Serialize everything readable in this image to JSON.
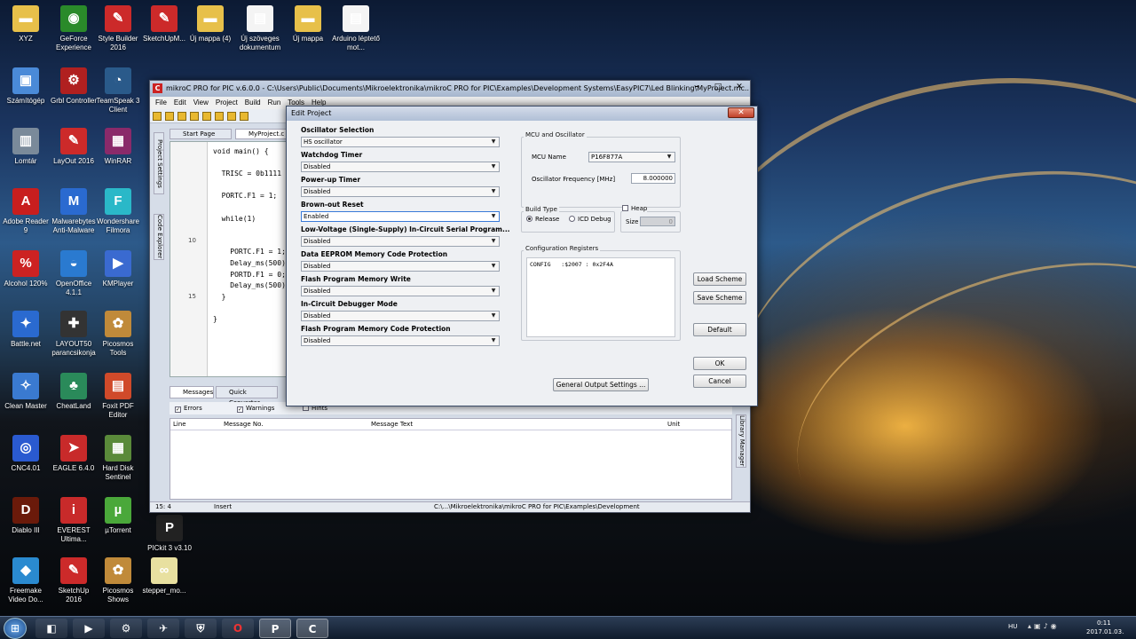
{
  "desktop": {
    "icons": [
      {
        "label": "XYZ",
        "icon": "folder-icon",
        "color": "#e7c04a",
        "glyph": "▬"
      },
      {
        "label": "GeForce Experience",
        "icon": "geforce-icon",
        "color": "#2a8a2a",
        "glyph": "◉"
      },
      {
        "label": "Style Builder 2016",
        "icon": "stylebuilder-icon",
        "color": "#cc2a2a",
        "glyph": "✎"
      },
      {
        "label": "SketchUpM...",
        "icon": "sketchup-icon",
        "color": "#cc2a2a",
        "glyph": "✎"
      },
      {
        "label": "Új mappa (4)",
        "icon": "folder-icon",
        "color": "#e7c04a",
        "glyph": "▬"
      },
      {
        "label": "Új szöveges dokumentum",
        "icon": "document-icon",
        "color": "#f4f4f4",
        "glyph": "▤"
      },
      {
        "label": "Új mappa",
        "icon": "folder-icon",
        "color": "#e7c04a",
        "glyph": "▬"
      },
      {
        "label": "Arduino léptető mot...",
        "icon": "document-icon",
        "color": "#f4f4f4",
        "glyph": "▤"
      },
      {
        "label": "Számítógép",
        "icon": "computer-icon",
        "color": "#4a8ad8",
        "glyph": "▣"
      },
      {
        "label": "Grbl Controller",
        "icon": "grbl-icon",
        "color": "#b02020",
        "glyph": "⚙"
      },
      {
        "label": "TeamSpeak 3 Client",
        "icon": "teamspeak-icon",
        "color": "#2a5a8a",
        "glyph": "◔"
      },
      {
        "label": "Lomtár",
        "icon": "recycle-bin-icon",
        "color": "#7a8a9a",
        "glyph": "▥"
      },
      {
        "label": "LayOut 2016",
        "icon": "layout-icon",
        "color": "#cc2a2a",
        "glyph": "✎"
      },
      {
        "label": "WinRAR",
        "icon": "winrar-icon",
        "color": "#8a2a6a",
        "glyph": "▦"
      },
      {
        "label": "Adobe Reader 9",
        "icon": "adobe-reader-icon",
        "color": "#c81e1e",
        "glyph": "A"
      },
      {
        "label": "Malwarebytes Anti-Malware",
        "icon": "malwarebytes-icon",
        "color": "#2a6ad0",
        "glyph": "M"
      },
      {
        "label": "Wondershare Filmora",
        "icon": "filmora-icon",
        "color": "#2ab8c8",
        "glyph": "F"
      },
      {
        "label": "Alcohol 120%",
        "icon": "alcohol-icon",
        "color": "#cc2222",
        "glyph": "%"
      },
      {
        "label": "OpenOffice 4.1.1",
        "icon": "openoffice-icon",
        "color": "#2a7ad0",
        "glyph": "◒"
      },
      {
        "label": "KMPlayer",
        "icon": "kmplayer-icon",
        "color": "#3a6ad0",
        "glyph": "▶"
      },
      {
        "label": "Battle.net",
        "icon": "battlenet-icon",
        "color": "#2a6ad0",
        "glyph": "✦"
      },
      {
        "label": "LAYOUT50 parancsikonja",
        "icon": "layout50-icon",
        "color": "#333333",
        "glyph": "✚"
      },
      {
        "label": "Picosmos Tools",
        "icon": "picosmos-icon",
        "color": "#c08a3a",
        "glyph": "✿"
      },
      {
        "label": "Clean Master",
        "icon": "clean-master-icon",
        "color": "#3a7ad0",
        "glyph": "✧"
      },
      {
        "label": "CheatLand",
        "icon": "cheatland-icon",
        "color": "#2a8a5a",
        "glyph": "♣"
      },
      {
        "label": "Foxit PDF Editor",
        "icon": "foxit-icon",
        "color": "#d04a2a",
        "glyph": "▤"
      },
      {
        "label": "CNC4.01",
        "icon": "cnc-icon",
        "color": "#2a5ad0",
        "glyph": "◎"
      },
      {
        "label": "EAGLE 6.4.0",
        "icon": "eagle-icon",
        "color": "#c82a2a",
        "glyph": "➤"
      },
      {
        "label": "Hard Disk Sentinel",
        "icon": "hds-icon",
        "color": "#5a8a3a",
        "glyph": "▦"
      },
      {
        "label": "Diablo III",
        "icon": "diablo-icon",
        "color": "#6a1a0a",
        "glyph": "D"
      },
      {
        "label": "EVEREST Ultima...",
        "icon": "everest-icon",
        "color": "#c82a2a",
        "glyph": "i"
      },
      {
        "label": "µTorrent",
        "icon": "utorrent-icon",
        "color": "#4aa83a",
        "glyph": "µ"
      },
      {
        "label": "Freemake Video Do...",
        "icon": "freemake-icon",
        "color": "#2a8ad0",
        "glyph": "◆"
      },
      {
        "label": "SketchUp 2016",
        "icon": "sketchup-icon",
        "color": "#cc2a2a",
        "glyph": "✎"
      },
      {
        "label": "Picosmos Shows",
        "icon": "picosmos-icon",
        "color": "#c08a3a",
        "glyph": "✿"
      },
      {
        "label": "stepper_mo...",
        "icon": "arduino-file-icon",
        "color": "#e8e0a0",
        "glyph": "∞"
      },
      {
        "label": "PICkit 3 v3.10",
        "icon": "pickit-icon",
        "color": "#222222",
        "glyph": "P"
      }
    ]
  },
  "ide": {
    "title": "mikroC PRO for PIC v.6.0.0 - C:\\Users\\Public\\Documents\\Mikroelektronika\\mikroC PRO for PIC\\Examples\\Development Systems\\EasyPIC7\\Led Blinking\\MyProject.mc...",
    "menu": [
      "File",
      "Edit",
      "View",
      "Project",
      "Build",
      "Run",
      "Tools",
      "Help"
    ],
    "tabs": [
      "Start Page",
      "MyProject.c"
    ],
    "side_tabs": [
      "Project Settings",
      "Code Explorer"
    ],
    "right_tab": "Library Manager",
    "code_lines": [
      {
        "num": "",
        "text": "void main() {"
      },
      {
        "num": "",
        "text": ""
      },
      {
        "num": "",
        "text": "  TRISC = 0b1111"
      },
      {
        "num": "",
        "text": ""
      },
      {
        "num": "",
        "text": "  PORTC.F1 = 1;"
      },
      {
        "num": "",
        "text": ""
      },
      {
        "num": "",
        "text": "  while(1)"
      },
      {
        "num": "",
        "text": ""
      },
      {
        "num": "10",
        "text": ""
      },
      {
        "num": "",
        "text": "    PORTC.F1 = 1;"
      },
      {
        "num": "",
        "text": "    Delay_ms(500)"
      },
      {
        "num": "",
        "text": "    PORTD.F1 = 0;"
      },
      {
        "num": "",
        "text": "    Delay_ms(500)"
      },
      {
        "num": "15",
        "text": "  }"
      },
      {
        "num": "",
        "text": ""
      },
      {
        "num": "",
        "text": "}"
      }
    ],
    "bottom_tabs": [
      "Messages",
      "Quick Converter"
    ],
    "filters": [
      "Errors",
      "Warnings",
      "Hints"
    ],
    "msg_columns": [
      "Line",
      "Message No.",
      "Message Text",
      "Unit"
    ],
    "status": {
      "pos": "15: 4",
      "mode": "Insert",
      "path": "C:\\...\\Mikroelektronika\\mikroC PRO for PIC\\Examples\\Development"
    }
  },
  "dialog": {
    "title": "Edit Project",
    "close": "✕",
    "settings": [
      {
        "label": "Oscillator Selection",
        "value": "HS oscillator"
      },
      {
        "label": "Watchdog Timer",
        "value": "Disabled"
      },
      {
        "label": "Power-up Timer",
        "value": "Disabled"
      },
      {
        "label": "Brown-out Reset",
        "value": "Enabled"
      },
      {
        "label": "Low-Voltage (Single-Supply) In-Circuit Serial Program...",
        "value": "Disabled"
      },
      {
        "label": "Data EEPROM Memory Code Protection",
        "value": "Disabled"
      },
      {
        "label": "Flash Program Memory Write",
        "value": "Disabled"
      },
      {
        "label": "In-Circuit Debugger Mode",
        "value": "Disabled"
      },
      {
        "label": "Flash Program Memory Code Protection",
        "value": "Disabled"
      }
    ],
    "mcu_group": "MCU and Oscillator",
    "mcu_name_label": "MCU Name",
    "mcu_name": "P16F877A",
    "osc_label": "Oscillator Frequency [MHz]",
    "osc_value": "8.000000",
    "build_type_label": "Build Type",
    "release_label": "Release",
    "icd_label": "ICD Debug",
    "heap_label": "Heap",
    "size_label": "Size",
    "size_value": "0",
    "config_group": "Configuration Registers",
    "config_text": "CONFIG   :$2007 : 0x2F4A",
    "buttons": {
      "load": "Load Scheme",
      "save": "Save Scheme",
      "default": "Default",
      "ok": "OK",
      "cancel": "Cancel",
      "general": "General Output Settings ..."
    }
  },
  "taskbar": {
    "lang": "HU",
    "time": "0:11",
    "date": "2017.01.03.",
    "apps": [
      {
        "glyph": "◧",
        "icon": "explorer-icon"
      },
      {
        "glyph": "▶",
        "icon": "media-player-icon"
      },
      {
        "glyph": "⚙",
        "icon": "world-of-warships-icon"
      },
      {
        "glyph": "✈",
        "icon": "world-of-warplanes-icon"
      },
      {
        "glyph": "⛨",
        "icon": "world-of-tanks-icon"
      },
      {
        "glyph": "O",
        "icon": "opera-icon"
      },
      {
        "glyph": "P",
        "icon": "pickit-taskbar-icon"
      },
      {
        "glyph": "C",
        "icon": "mikroc-taskbar-icon"
      }
    ]
  }
}
